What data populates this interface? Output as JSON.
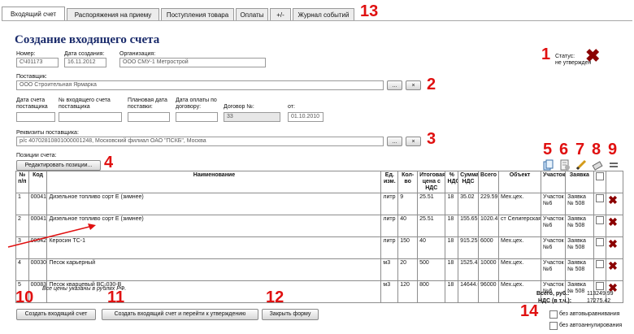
{
  "tabs": [
    {
      "label": "Входящий счет",
      "active": true
    },
    {
      "label": "Распоряжения на приему",
      "active": false
    },
    {
      "label": "Поступления товара",
      "active": false
    },
    {
      "label": "Оплаты",
      "active": false
    },
    {
      "label": "+/-",
      "active": false
    },
    {
      "label": "Журнал событий",
      "active": false
    }
  ],
  "page_title": "Создание входящего счета",
  "header": {
    "number_label": "Номер:",
    "number_value": "СЧ01173",
    "date_label": "Дата создания:",
    "date_value": "16.11.2012",
    "org_label": "Организация:",
    "org_value": "ООО СМУ-1 Метрострой"
  },
  "status": {
    "label": "Статус:",
    "value": "не утвержден"
  },
  "supplier": {
    "label": "Поставщик:",
    "value": "ООО Строительная Ярмарка"
  },
  "dates": {
    "supplier_invoice_date_label": "Дата счета поставщика",
    "supplier_invoice_no_label": "№ входящего счета поставщика",
    "planned_delivery_label": "Плановая дата поставки:",
    "payment_date_label": "Дата оплаты по договору:",
    "contract_label": "Договор №:",
    "contract_value": "33",
    "from_label": "от:",
    "from_value": "01.10.2010"
  },
  "requisites": {
    "label": "Реквизиты поставщика:",
    "value": "р/с 40702810801000001248, Московский филиал ОАО \"ПСКБ\", Москва"
  },
  "positions": {
    "label": "Позиции счета:",
    "edit_button": "Редактировать позиции...",
    "columns": [
      "№ п/п",
      "Код",
      "Наименование",
      "Ед. изм.",
      "Кол-во",
      "Итоговая цена с НДС",
      "% НДС",
      "Сумма НДС",
      "Всего",
      "Объект",
      "Участок",
      "Заявка",
      "",
      ""
    ],
    "rows": [
      {
        "n": "1",
        "code": "00041",
        "name": "Дизельное топливо сорт Е (зимнее)",
        "unit": "литр",
        "qty": "9",
        "price": "25.51",
        "vat_pct": "18",
        "vat_sum": "35.02",
        "total": "229.59",
        "object": "Мех.цех.",
        "site": "Участок №6",
        "request": "Заявка № 508"
      },
      {
        "n": "2",
        "code": "00041",
        "name": "Дизельное топливо сорт Е (зимнее)",
        "unit": "литр",
        "qty": "40",
        "price": "25.51",
        "vat_pct": "18",
        "vat_sum": "155.65",
        "total": "1020.4",
        "object": "ст Селигерская",
        "site": "Участок №6",
        "request": "Заявка № 508"
      },
      {
        "n": "3",
        "code": "00042",
        "name": "Керосин ТС-1",
        "unit": "литр",
        "qty": "150",
        "price": "40",
        "vat_pct": "18",
        "vat_sum": "915.25",
        "total": "6000",
        "object": "Мех.цех.",
        "site": "Участок №6",
        "request": "Заявка № 508"
      },
      {
        "n": "4",
        "code": "00030",
        "name": "Песок карьерный",
        "unit": "м3",
        "qty": "20",
        "price": "500",
        "vat_pct": "18",
        "vat_sum": "1525.42",
        "total": "10000",
        "object": "Мех.цех.",
        "site": "Участок №6",
        "request": "Заявка № 508"
      },
      {
        "n": "5",
        "code": "00083",
        "name": "Песок кварцевый ВС-030-В",
        "unit": "м3",
        "qty": "120",
        "price": "800",
        "vat_pct": "18",
        "vat_sum": "14644.07",
        "total": "96000",
        "object": "Мех.цех.",
        "site": "Участок №6",
        "request": "Заявка № 508"
      }
    ],
    "footnote": "Все цены указаны в рублях РФ."
  },
  "totals": {
    "total_label": "Всего, руб.:",
    "total_value": "113249.99",
    "vat_label": "НДС (в т.ч.):",
    "vat_value": "17275.42"
  },
  "buttons": {
    "create": "Создать входящий счет",
    "create_approve": "Создать входящий счет и перейти к утверждению",
    "close": "Закрыть форму"
  },
  "options": {
    "no_autoalign": "без автовыравнивания",
    "no_autocancel": "без автоаннулирования"
  },
  "annotations": [
    "1",
    "2",
    "3",
    "4",
    "5",
    "6",
    "7",
    "8",
    "9",
    "10",
    "11",
    "12",
    "13",
    "14"
  ],
  "colors": {
    "annotation": "#e01010",
    "delete": "#8b0000",
    "title": "#1a2b6b"
  }
}
